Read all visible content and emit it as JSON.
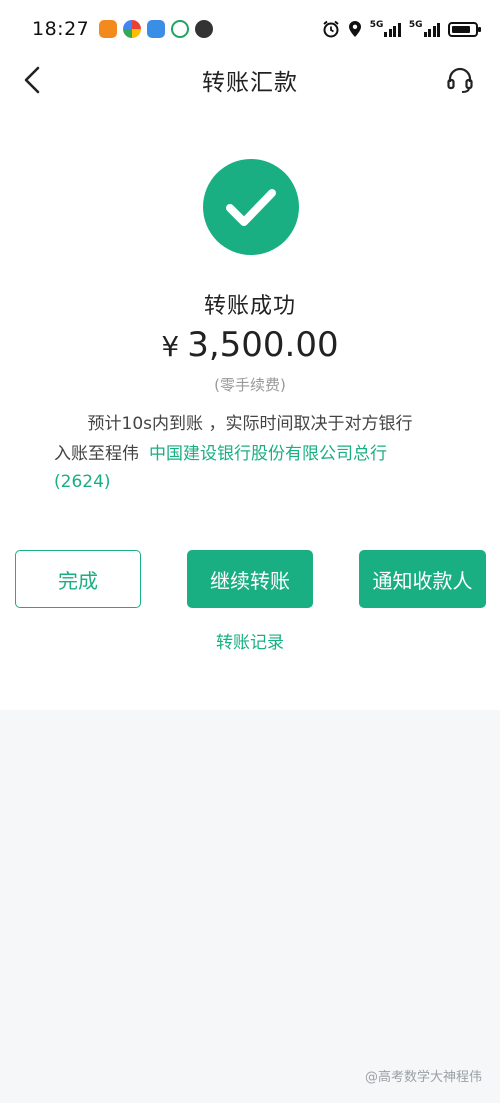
{
  "status_bar": {
    "time": "18:27",
    "network_1": "5G",
    "network_2": "5G",
    "notification_icons": [
      {
        "name": "shopping-app-icon",
        "color": "#f28a1e"
      },
      {
        "name": "pinwheel-app-icon",
        "color": "#2c7be5"
      },
      {
        "name": "message-app-icon",
        "color": "#3a8ee6"
      },
      {
        "name": "sync-app-icon",
        "color": "#1fa463"
      },
      {
        "name": "wechat-icon",
        "color": "#333333"
      }
    ]
  },
  "header": {
    "title": "转账汇款"
  },
  "result": {
    "status_text": "转账成功",
    "currency_symbol": "¥",
    "amount": "3,500.00",
    "fee_note": "(零手续费)",
    "eta_text": "预计10s内到账 ，实际时间取决于对方银行",
    "credit_prefix": "入账至程伟",
    "bank_name": "中国建设银行股份有限公司总行",
    "account_suffix": "(2624)"
  },
  "actions": {
    "done_label": "完成",
    "continue_label": "继续转账",
    "notify_label": "通知收款人",
    "records_label": "转账记录"
  },
  "watermark": {
    "text": "@高考数学大神程伟"
  },
  "colors": {
    "accent": "#1aaf82",
    "background": "#f6f7f8"
  }
}
